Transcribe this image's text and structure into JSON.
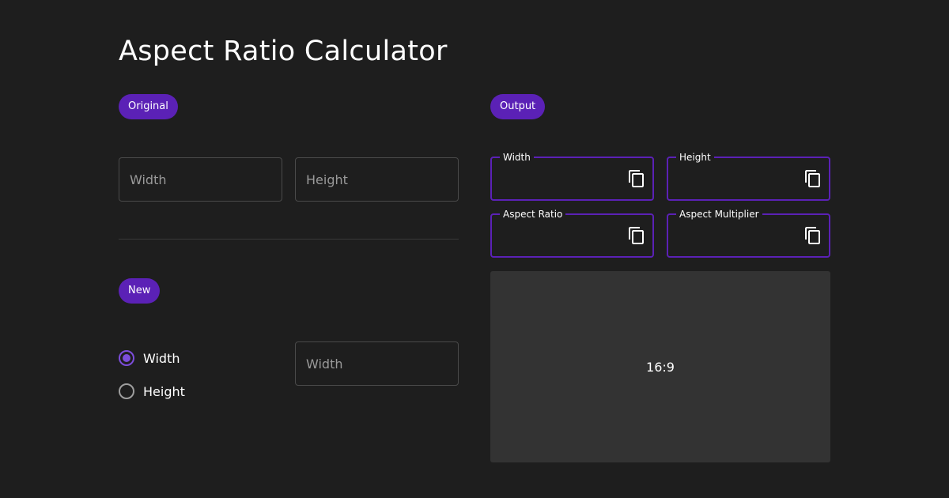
{
  "header": {
    "title": "Aspect Ratio Calculator"
  },
  "original": {
    "chip": "Original",
    "width_placeholder": "Width",
    "height_placeholder": "Height"
  },
  "new": {
    "chip": "New",
    "options": [
      {
        "label": "Width",
        "checked": true
      },
      {
        "label": "Height",
        "checked": false
      }
    ],
    "input_placeholder": "Width"
  },
  "output": {
    "chip": "Output",
    "fields": [
      {
        "label": "Width",
        "value": ""
      },
      {
        "label": "Height",
        "value": ""
      },
      {
        "label": "Aspect Ratio",
        "value": ""
      },
      {
        "label": "Aspect Multiplier",
        "value": ""
      }
    ],
    "copy_icon": "copy-icon",
    "preview_text": "16:9"
  },
  "colors": {
    "background": "#1e1e1e",
    "accent": "#5b21b6",
    "radio_accent": "#7c4ddb",
    "preview_bg": "#333333"
  }
}
